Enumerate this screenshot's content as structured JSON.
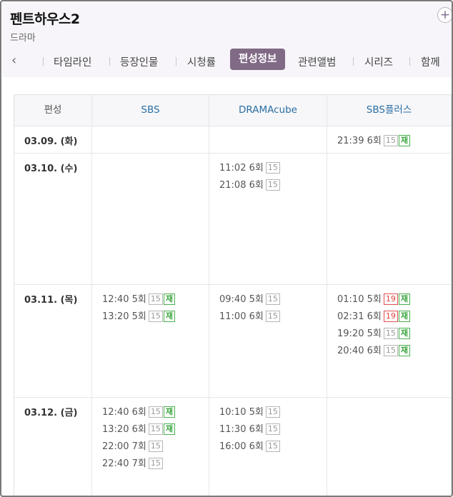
{
  "header": {
    "title": "펜트하우스2",
    "subtitle": "드라마"
  },
  "tabs": {
    "items": [
      {
        "label": "타임라인",
        "active": false
      },
      {
        "label": "등장인물",
        "active": false
      },
      {
        "label": "시청률",
        "active": false
      },
      {
        "label": "편성정보",
        "active": true
      },
      {
        "label": "관련앨범",
        "active": false
      },
      {
        "label": "시리즈",
        "active": false
      },
      {
        "label": "함께",
        "active": false
      }
    ]
  },
  "schedule": {
    "columns": [
      "편성",
      "SBS",
      "DRAMAcube",
      "SBS플러스"
    ],
    "rows": [
      {
        "date": "03.09. (화)",
        "sbs": [],
        "dramacube": [],
        "sbsplus": [
          {
            "time": "21:39",
            "ep": "6회",
            "rating": "15",
            "rerun": "재"
          }
        ]
      },
      {
        "date": "03.10. (수)",
        "sbs": [],
        "dramacube": [
          {
            "time": "11:02",
            "ep": "6회",
            "rating": "15",
            "rerun": ""
          },
          {
            "time": "21:08",
            "ep": "6회",
            "rating": "15",
            "rerun": ""
          }
        ],
        "sbsplus": []
      },
      {
        "date": "03.11. (목)",
        "sbs": [
          {
            "time": "12:40",
            "ep": "5회",
            "rating": "15",
            "rerun": "재"
          },
          {
            "time": "13:20",
            "ep": "5회",
            "rating": "15",
            "rerun": "재"
          }
        ],
        "dramacube": [
          {
            "time": "09:40",
            "ep": "5회",
            "rating": "15",
            "rerun": ""
          },
          {
            "time": "11:00",
            "ep": "6회",
            "rating": "15",
            "rerun": ""
          }
        ],
        "sbsplus": [
          {
            "time": "01:10",
            "ep": "5회",
            "rating": "19",
            "rerun": "재"
          },
          {
            "time": "02:31",
            "ep": "6회",
            "rating": "19",
            "rerun": "재"
          },
          {
            "time": "19:20",
            "ep": "5회",
            "rating": "15",
            "rerun": "재"
          },
          {
            "time": "20:40",
            "ep": "6회",
            "rating": "15",
            "rerun": "재"
          }
        ]
      },
      {
        "date": "03.12. (금)",
        "sbs": [
          {
            "time": "12:40",
            "ep": "6회",
            "rating": "15",
            "rerun": "재"
          },
          {
            "time": "13:20",
            "ep": "6회",
            "rating": "15",
            "rerun": "재"
          },
          {
            "time": "22:00",
            "ep": "7회",
            "rating": "15",
            "rerun": ""
          },
          {
            "time": "22:40",
            "ep": "7회",
            "rating": "15",
            "rerun": ""
          }
        ],
        "dramacube": [
          {
            "time": "10:10",
            "ep": "5회",
            "rating": "15",
            "rerun": ""
          },
          {
            "time": "11:30",
            "ep": "6회",
            "rating": "15",
            "rerun": ""
          },
          {
            "time": "16:00",
            "ep": "6회",
            "rating": "15",
            "rerun": ""
          }
        ],
        "sbsplus": []
      }
    ]
  },
  "colors": {
    "accent": "#816a86",
    "channel_header": "#2a6ea3",
    "rating19": "#e04040",
    "rerun": "#36a33a"
  }
}
